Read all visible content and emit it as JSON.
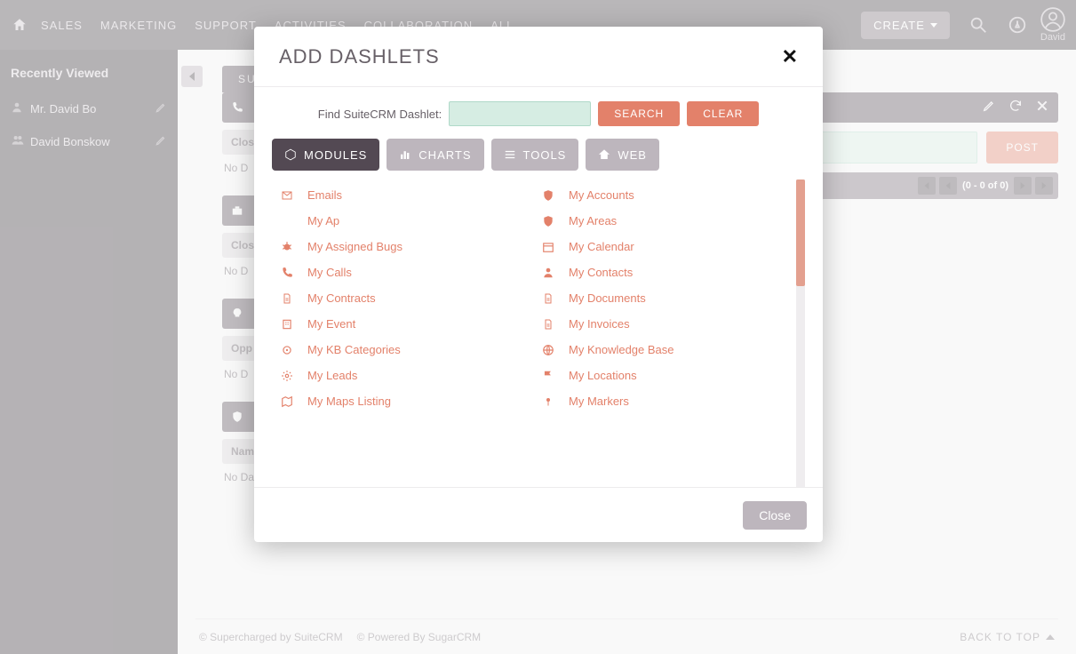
{
  "nav": {
    "items": [
      "SALES",
      "MARKETING",
      "SUPPORT",
      "ACTIVITIES",
      "COLLABORATION",
      "ALL"
    ],
    "create": "CREATE",
    "user": "David"
  },
  "sidebar": {
    "heading": "Recently Viewed",
    "items": [
      {
        "label": "Mr. David Bo"
      },
      {
        "label": "David Bonskow"
      }
    ]
  },
  "page": {
    "tab": "SUITE",
    "closed_label": "Clos",
    "nodata": "No D",
    "opp": "Opp",
    "nam": "Nam",
    "nodata_full": "No Da",
    "post_btn": "POST",
    "pager": "(0 - 0 of 0)"
  },
  "footer": {
    "left1": "© Supercharged by SuiteCRM",
    "left2": "© Powered By SugarCRM",
    "btt": "BACK TO TOP"
  },
  "modal": {
    "title": "ADD DASHLETS",
    "find_label": "Find SuiteCRM Dashlet:",
    "search_btn": "SEARCH",
    "clear_btn": "CLEAR",
    "tabs": {
      "modules": "MODULES",
      "charts": "CHARTS",
      "tools": "TOOLS",
      "web": "WEB"
    },
    "close_btn": "Close",
    "left_items": [
      "Emails",
      "My Ap",
      "My Assigned Bugs",
      "My Calls",
      "My Contracts",
      "My Event",
      "My KB Categories",
      "My Leads",
      "My Maps Listing"
    ],
    "right_items": [
      "My Accounts",
      "My Areas",
      "My Calendar",
      "My Contacts",
      "My Documents",
      "My Invoices",
      "My Knowledge Base",
      "My Locations",
      "My Markers"
    ]
  }
}
